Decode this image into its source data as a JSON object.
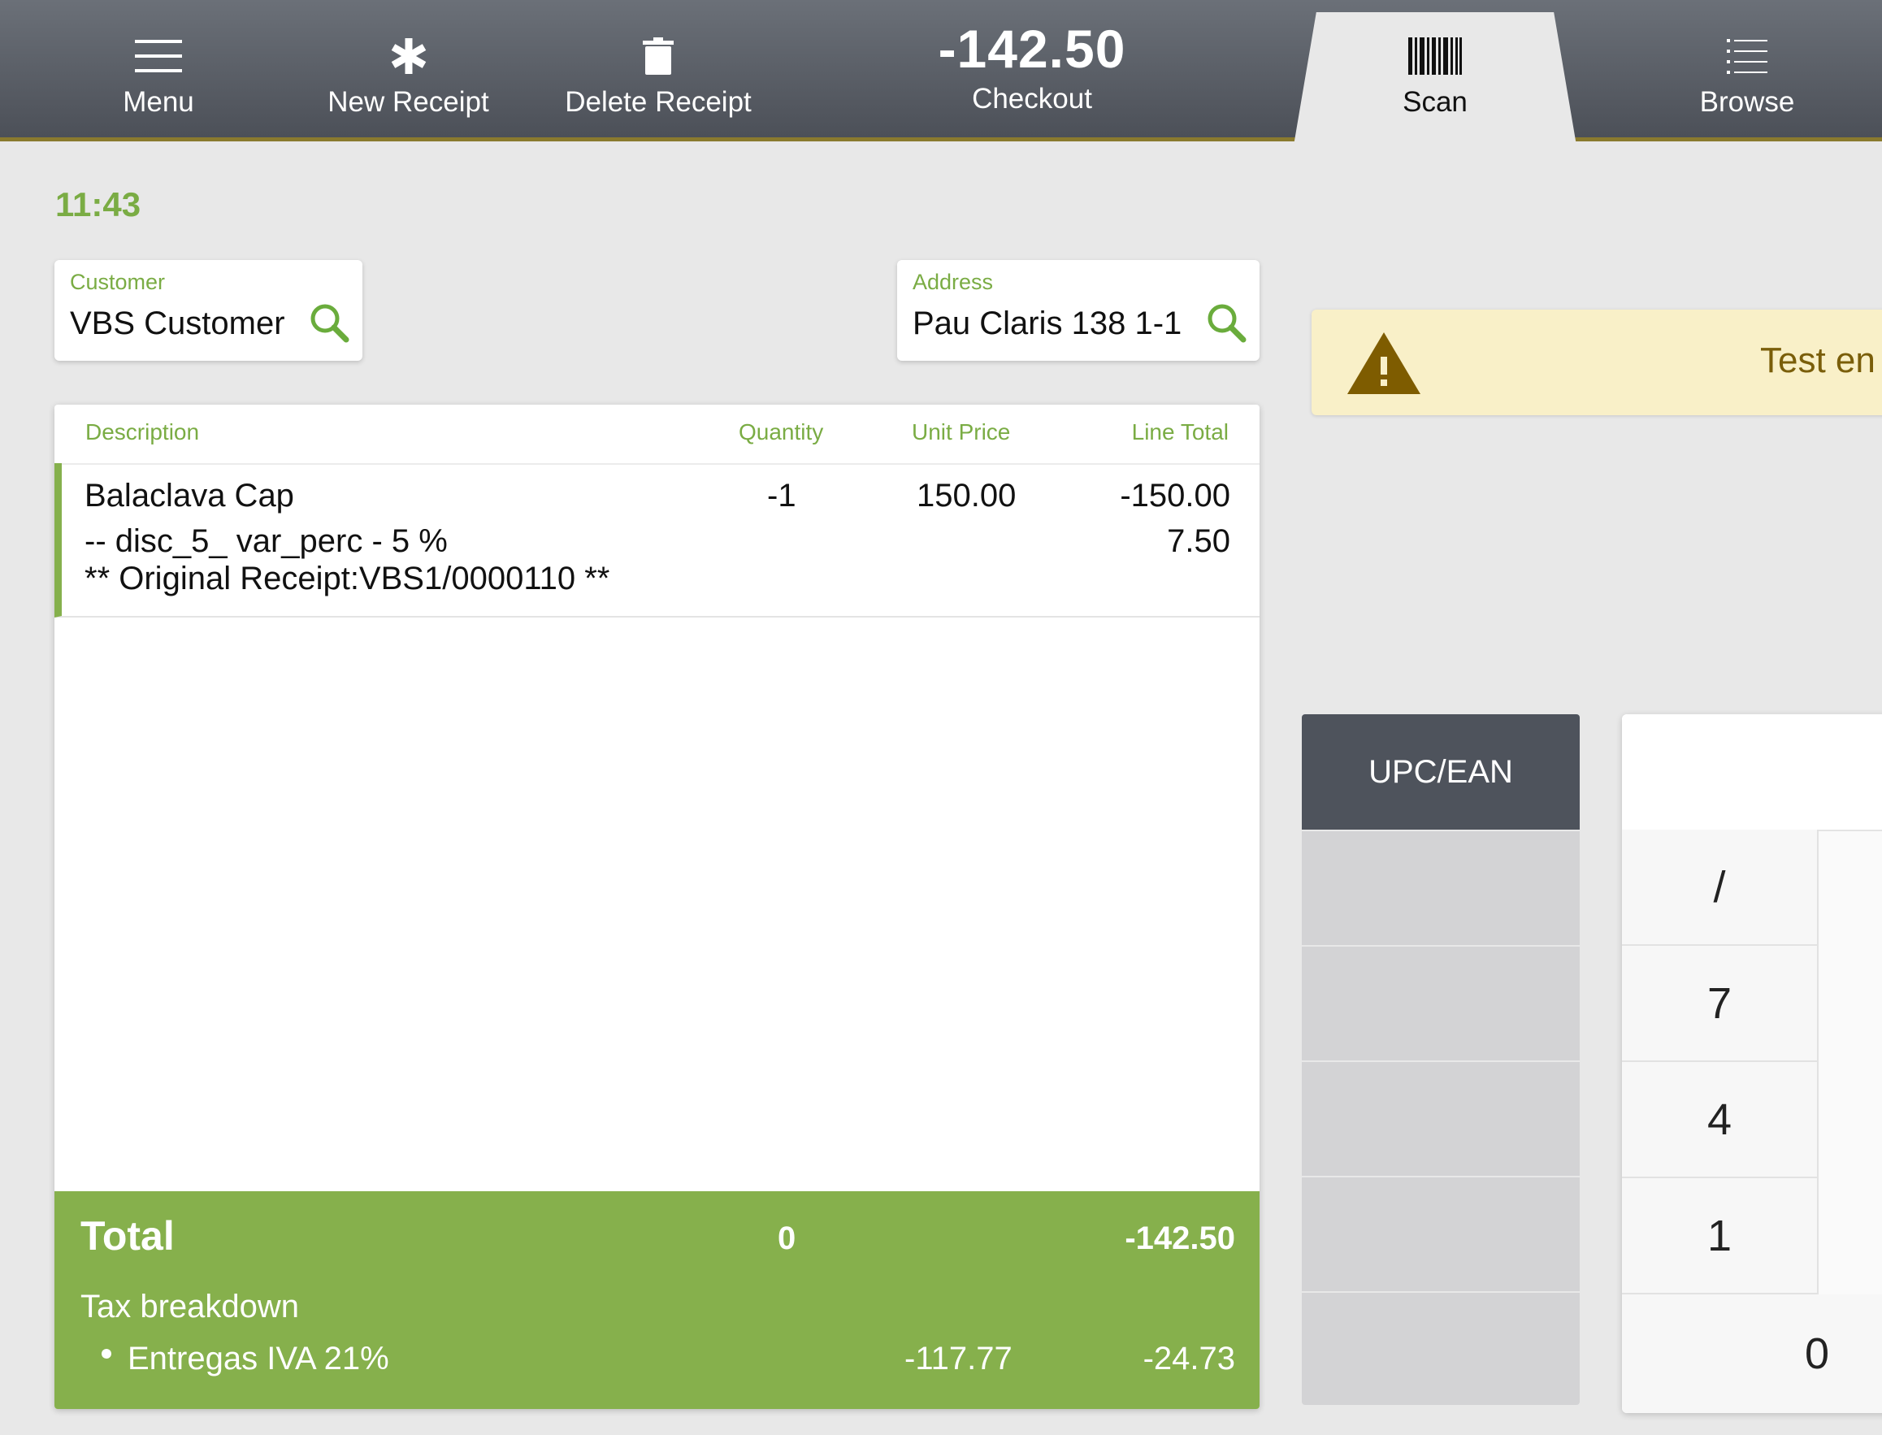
{
  "toolbar": {
    "menu_label": "Menu",
    "new_receipt_label": "New Receipt",
    "delete_receipt_label": "Delete Receipt",
    "checkout_amount": "-142.50",
    "checkout_label": "Checkout",
    "scan_label": "Scan",
    "browse_label": "Browse"
  },
  "clock": "11:43",
  "customer": {
    "label": "Customer",
    "value": "VBS Customer"
  },
  "address": {
    "label": "Address",
    "value": "Pau Claris 138 1-1"
  },
  "receipt": {
    "columns": {
      "description": "Description",
      "quantity": "Quantity",
      "unit_price": "Unit Price",
      "line_total": "Line Total"
    },
    "lines": [
      {
        "description": "Balaclava Cap",
        "quantity": "-1",
        "unit_price": "150.00",
        "line_total": "-150.00",
        "discount_text": "-- disc_5_ var_perc - 5 %",
        "discount_amount": "7.50",
        "note": "** Original Receipt:VBS1/0000110 **"
      }
    ],
    "total": {
      "label": "Total",
      "quantity": "0",
      "amount": "-142.50",
      "tax_label": "Tax breakdown",
      "tax_items": [
        {
          "name": "Entregas IVA 21%",
          "base": "-117.77",
          "tax": "-24.73"
        }
      ]
    }
  },
  "warning": {
    "text": "Test en"
  },
  "keypad": {
    "upc_label": "UPC/EAN",
    "keys": [
      "/",
      "7",
      "4",
      "1",
      "0"
    ]
  },
  "colors": {
    "accent_green": "#7aac44",
    "toolbar_dark": "#4e535c",
    "warning_bg": "#f9f0c8",
    "warning_text": "#7a5e0a"
  }
}
